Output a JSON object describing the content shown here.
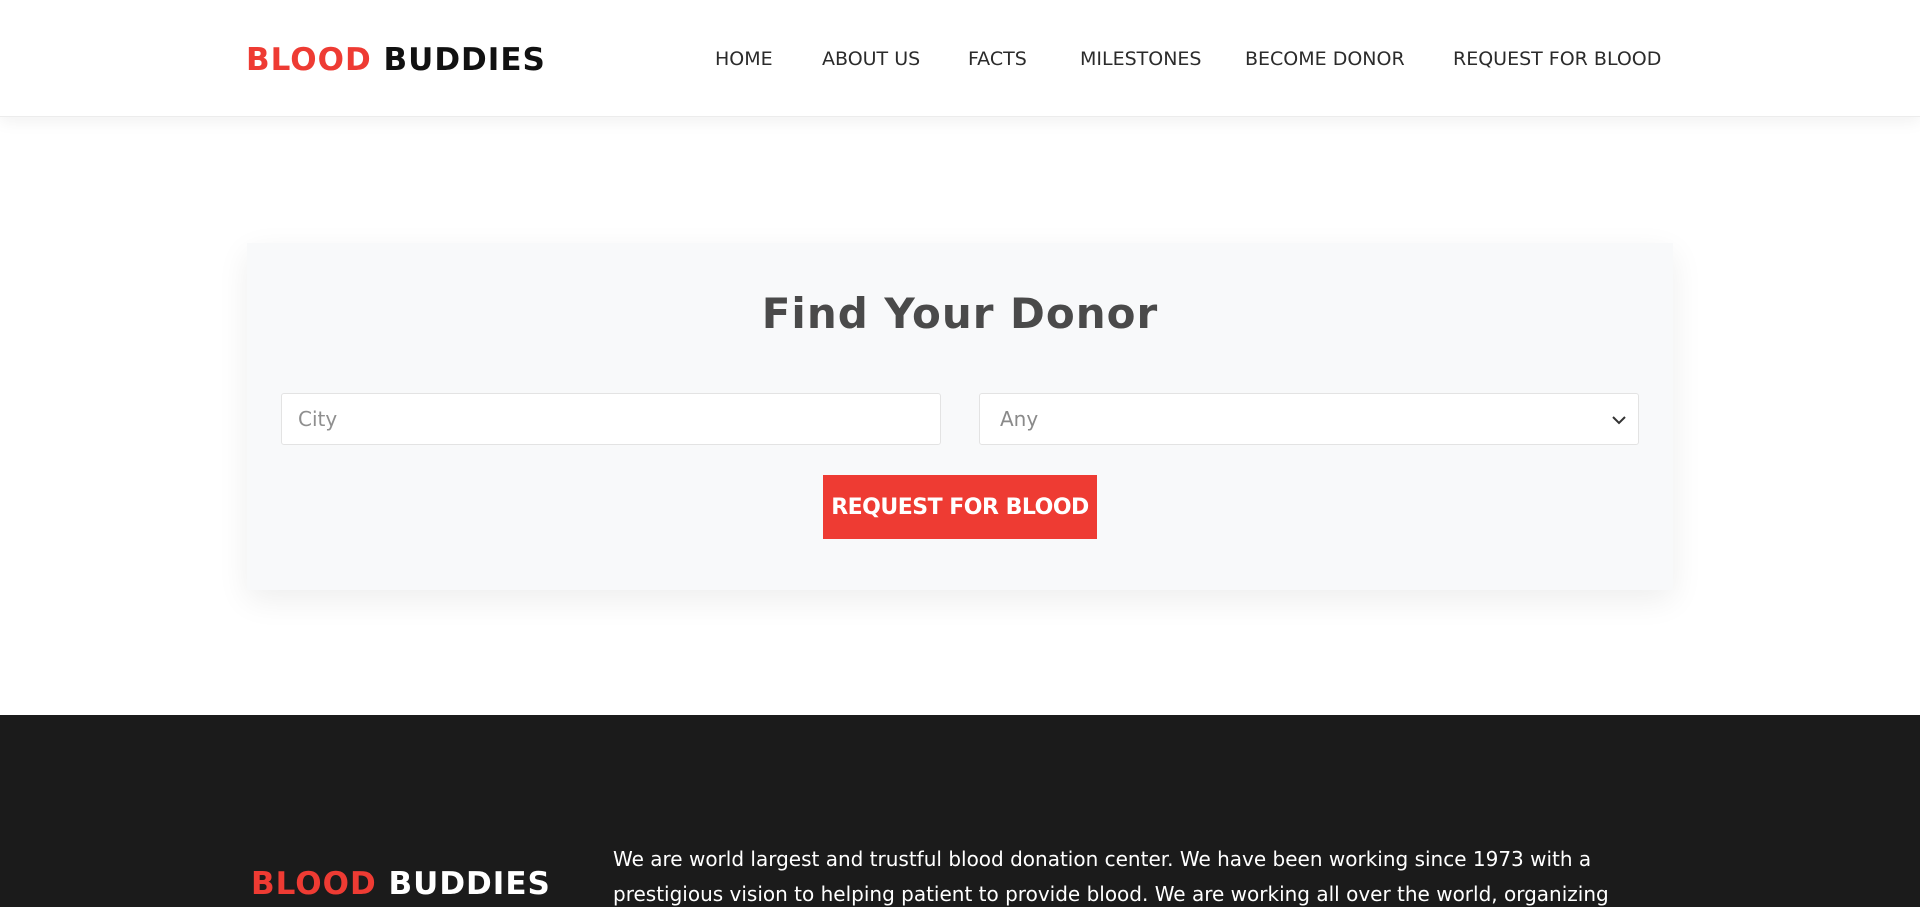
{
  "brand": {
    "part1": "BLOOD",
    "part2": "BUDDIES"
  },
  "nav": {
    "items": [
      {
        "label": "HOME"
      },
      {
        "label": "ABOUT US"
      },
      {
        "label": "FACTS"
      },
      {
        "label": "MILESTONES"
      },
      {
        "label": "BECOME DONOR"
      },
      {
        "label": "REQUEST FOR BLOOD"
      }
    ]
  },
  "search": {
    "title": "Find Your Donor",
    "city_placeholder": "City",
    "city_value": "",
    "blood_group_selected": "Any",
    "submit_label": "REQUEST FOR BLOOD"
  },
  "footer": {
    "brand_part1": "BLOOD",
    "brand_part2": "BUDDIES",
    "about_text": "We are world largest and trustful blood donation center. We have been working since 1973 with a prestigious vision to helping patient to provide blood. We are working all over the world, organizing"
  },
  "colors": {
    "accent": "#ee3b33",
    "footer_bg": "#1b1b1b",
    "card_bg": "#f8f9fa",
    "nav_text": "#2b2b2b"
  }
}
